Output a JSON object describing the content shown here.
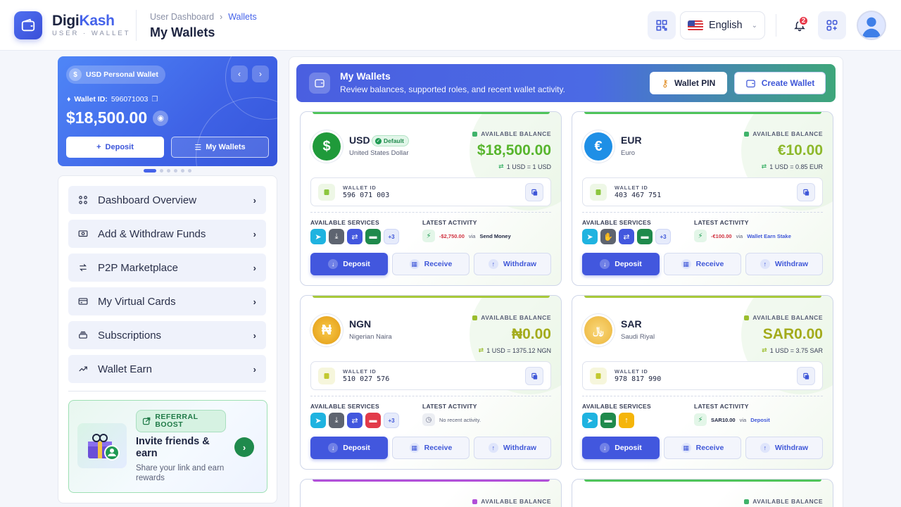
{
  "header": {
    "brand_first": "Digi",
    "brand_second": "Kash",
    "brand_sub": "USER · WALLET",
    "breadcrumb_parent": "User Dashboard",
    "breadcrumb_current": "Wallets",
    "page_title": "My Wallets",
    "language": "English",
    "notification_count": "2"
  },
  "promo": {
    "wallet_name": "USD Personal Wallet",
    "wallet_id_label": "Wallet ID:",
    "wallet_id": "596071003",
    "balance": "$18,500.00",
    "deposit_label": "Deposit",
    "my_wallets_label": "My Wallets"
  },
  "nav": {
    "items": [
      {
        "label": "Dashboard Overview",
        "icon": "grid-icon"
      },
      {
        "label": "Add & Withdraw Funds",
        "icon": "cash-icon"
      },
      {
        "label": "P2P Marketplace",
        "icon": "swap-icon"
      },
      {
        "label": "My Virtual Cards",
        "icon": "card-icon"
      },
      {
        "label": "Subscriptions",
        "icon": "layers-icon"
      },
      {
        "label": "Wallet Earn",
        "icon": "trend-icon"
      }
    ]
  },
  "referral": {
    "badge": "REFERRAL BOOST",
    "title": "Invite friends & earn",
    "subtitle": "Share your link and earn rewards"
  },
  "banner": {
    "title": "My Wallets",
    "subtitle": "Review balances, supported roles, and recent wallet activity.",
    "pin_label": "Wallet PIN",
    "create_label": "Create Wallet"
  },
  "labels": {
    "available_balance": "AVAILABLE BALANCE",
    "wallet_id": "WALLET ID",
    "available_services": "AVAILABLE SERVICES",
    "latest_activity": "LATEST ACTIVITY",
    "via": "via",
    "default": "Default",
    "deposit": "Deposit",
    "receive": "Receive",
    "withdraw": "Withdraw",
    "no_activity": "No recent activity."
  },
  "colors": {
    "accent": "#4257de",
    "success": "#1f9a53",
    "balance_green": "#57b52d",
    "balance_olive": "#a3ab1b",
    "danger": "#d0303f"
  },
  "wallets": [
    {
      "code": "USD",
      "name": "United States Dollar",
      "symbol": "$",
      "balance": "$18,500.00",
      "rate": "1 USD = 1 USD",
      "wallet_id": "596 071 003",
      "activity_amount": "-$2,750.00",
      "activity_via": "Send Money",
      "services_more": "+3"
    },
    {
      "code": "EUR",
      "name": "Euro",
      "symbol": "€",
      "balance": "€10.00",
      "rate": "1 USD = 0.85 EUR",
      "wallet_id": "403 467 751",
      "activity_amount": "-€100.00",
      "activity_via": "Wallet Earn Stake",
      "services_more": "+3"
    },
    {
      "code": "NGN",
      "name": "Nigerian Naira",
      "symbol": "₦",
      "balance": "₦0.00",
      "rate": "1 USD = 1375.12 NGN",
      "wallet_id": "510 027 576",
      "activity_amount": "",
      "activity_via": "",
      "services_more": "+3"
    },
    {
      "code": "SAR",
      "name": "Saudi Riyal",
      "symbol": "﷼",
      "balance": "SAR0.00",
      "rate": "1 USD = 3.75 SAR",
      "wallet_id": "978 817 990",
      "activity_amount": "SAR10.00",
      "activity_via": "Deposit",
      "services_more": ""
    }
  ]
}
